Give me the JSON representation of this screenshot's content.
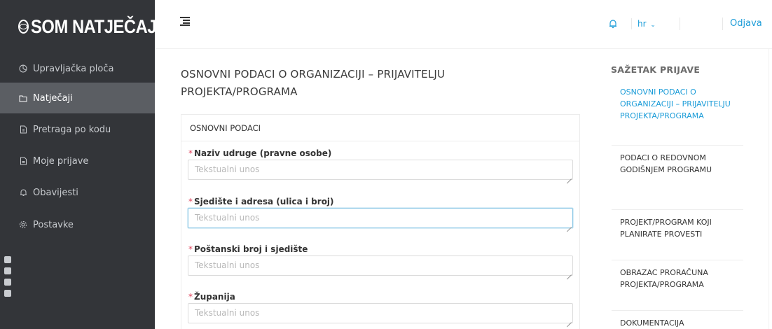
{
  "brand": {
    "name": "SOM NATJEČAJI"
  },
  "sidebar": {
    "items": [
      {
        "label": "Upravljačka ploča",
        "icon": "dashboard-icon"
      },
      {
        "label": "Natječaji",
        "icon": "folder-icon",
        "active": true
      },
      {
        "label": "Pretraga po kodu",
        "icon": "file-icon"
      },
      {
        "label": "Moje prijave",
        "icon": "document-icon"
      },
      {
        "label": "Obavijesti",
        "icon": "bell-icon"
      },
      {
        "label": "Postavke",
        "icon": "gear-icon"
      }
    ]
  },
  "topbar": {
    "language": "hr",
    "logout": "Odjava"
  },
  "main": {
    "title": "OSNOVNI PODACI O ORGANIZACIJI – PRIJAVITELJU PROJEKTA/PROGRAMA",
    "section": "OSNOVNI PODACI",
    "fields": [
      {
        "label": "Naziv udruge (pravne osobe)",
        "placeholder": "Tekstualni unos",
        "required": "*"
      },
      {
        "label": "Sjedište i adresa (ulica i broj)",
        "placeholder": "Tekstualni unos",
        "required": "*"
      },
      {
        "label": "Poštanski broj i sjedište",
        "placeholder": "Tekstualni unos",
        "required": "*"
      },
      {
        "label": "Županija",
        "placeholder": "Tekstualni unos",
        "required": "*"
      }
    ]
  },
  "summary": {
    "title": "SAŽETAK PRIJAVE",
    "items": [
      {
        "label": "OSNOVNI PODACI O ORGANIZACIJI – PRIJAVITELJU PROJEKTA/PROGRAMA",
        "active": true
      },
      {
        "label": "PODACI O REDOVNOM GODIŠNJEM PROGRAMU"
      },
      {
        "label": "PROJEKT/PROGRAM KOJI PLANIRATE PROVESTI"
      },
      {
        "label": "OBRAZAC PRORAČUNA PROJEKTA/PROGRAMA"
      },
      {
        "label": "DOKUMENTACIJA"
      }
    ]
  },
  "colors": {
    "sidebar_bg": "#333539",
    "sidebar_active": "#5b5e63",
    "accent": "#1b9cd8",
    "required": "#e0405b"
  }
}
